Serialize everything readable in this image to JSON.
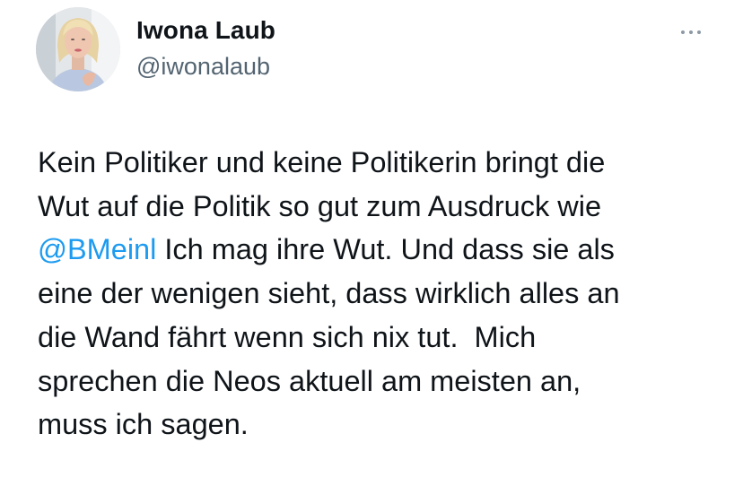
{
  "author": {
    "name": "Iwona Laub",
    "handle": "@iwonalaub"
  },
  "menu_icon": "more-horizontal-icon",
  "colors": {
    "text": "#0f1419",
    "secondary": "#536471",
    "link": "#1d9bf0"
  },
  "tweet": {
    "line1": "Kein Politiker und keine Politikerin bringt die",
    "line2": "Wut auf die Politik so gut zum Ausdruck wie",
    "mention": "@BMeinl",
    "line3_rest": " Ich mag ihre Wut. Und dass sie als",
    "line4": "eine der wenigen sieht, dass wirklich alles an",
    "line5": "die Wand fährt wenn sich nix tut.  Mich",
    "line6": "sprechen die Neos aktuell am meisten an,",
    "line7": "muss ich sagen."
  }
}
